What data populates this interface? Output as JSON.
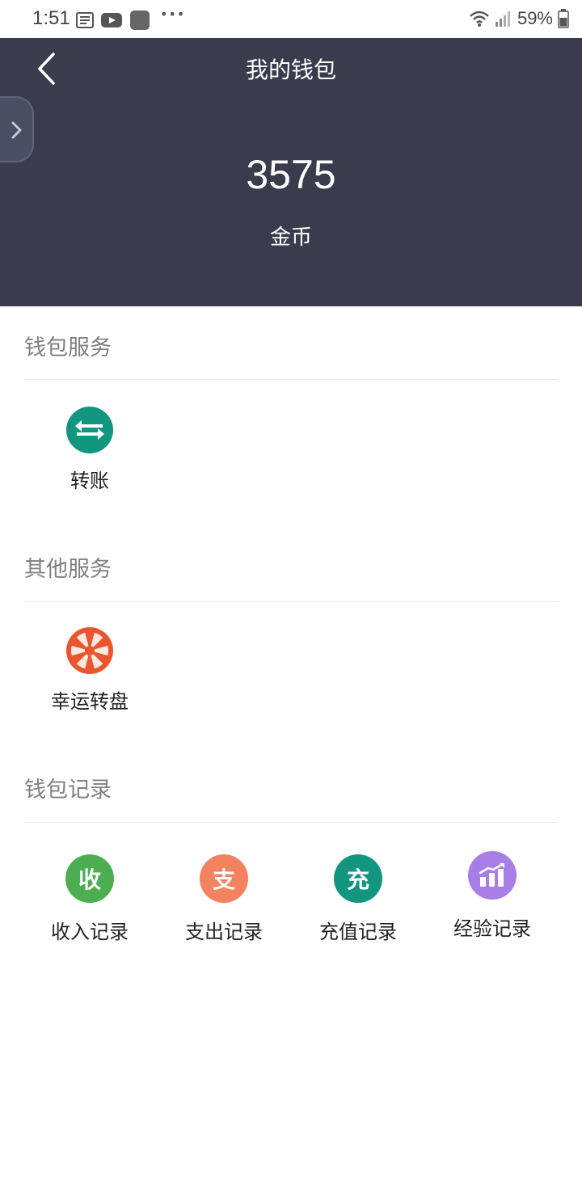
{
  "status_bar": {
    "time": "1:51",
    "battery": "59%"
  },
  "header": {
    "title": "我的钱包",
    "balance": "3575",
    "balance_unit": "金币"
  },
  "sections": {
    "wallet_services": {
      "title": "钱包服务",
      "items": [
        {
          "label": "转账",
          "icon": "transfer-icon",
          "color": "#12967f"
        }
      ]
    },
    "other_services": {
      "title": "其他服务",
      "items": [
        {
          "label": "幸运转盘",
          "icon": "lucky-wheel-icon",
          "color": "#e8552f"
        }
      ]
    },
    "wallet_records": {
      "title": "钱包记录",
      "items": [
        {
          "label": "收入记录",
          "glyph": "收",
          "icon": "income-icon",
          "color": "#4cae50"
        },
        {
          "label": "支出记录",
          "glyph": "支",
          "icon": "expense-icon",
          "color": "#f3825f"
        },
        {
          "label": "充值记录",
          "glyph": "充",
          "icon": "recharge-icon",
          "color": "#12967f"
        },
        {
          "label": "经验记录",
          "icon": "experience-chart-icon",
          "color": "#a77de6"
        }
      ]
    }
  }
}
